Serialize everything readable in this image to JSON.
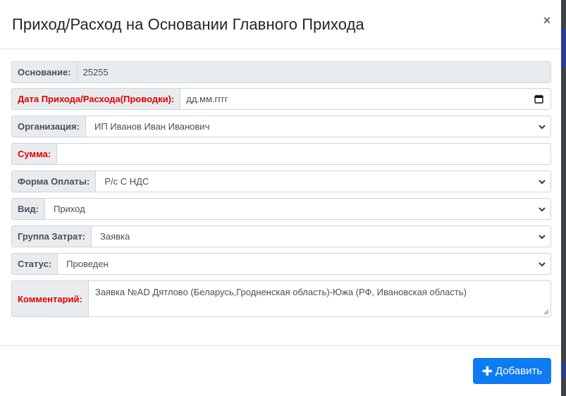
{
  "modal": {
    "title": "Приход/Расход на Основании Главного Прихода",
    "close_label": "×"
  },
  "form": {
    "osnovanie": {
      "label": "Основание:",
      "value": "25255"
    },
    "date": {
      "label": "Дата Прихода/Расхода(Проводки):",
      "placeholder": "дд.мм.гггг"
    },
    "organization": {
      "label": "Организация:",
      "value": "ИП Иванов Иван Иванович"
    },
    "summa": {
      "label": "Сумма:",
      "value": ""
    },
    "payment_form": {
      "label": "Форма Оплаты:",
      "value": "Р/с С НДС"
    },
    "vid": {
      "label": "Вид:",
      "value": "Приход"
    },
    "cost_group": {
      "label": "Группа Затрат:",
      "value": "Заявка"
    },
    "status": {
      "label": "Статус:",
      "value": "Проведен"
    },
    "comment": {
      "label": "Комментарий:",
      "value": "Заявка №AD Дятлово (Беларусь,Гродненская область)-Южа (РФ, Ивановская область)"
    }
  },
  "footer": {
    "add_label": "Добавить",
    "add_icon": "plus-icon"
  },
  "colors": {
    "accent": "#0d7bf1",
    "required_label": "#e00000"
  }
}
